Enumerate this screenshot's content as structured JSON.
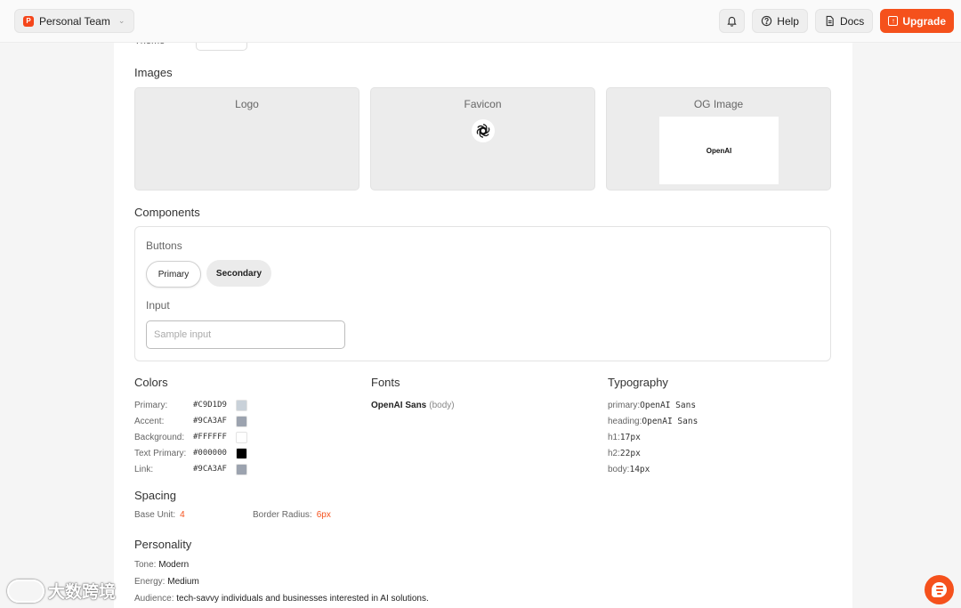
{
  "topbar": {
    "team_name": "Personal Team",
    "team_badge": "P",
    "help_label": "Help",
    "docs_label": "Docs",
    "upgrade_label": "Upgrade"
  },
  "theme": {
    "label": "Theme"
  },
  "images": {
    "title": "Images",
    "logo_label": "Logo",
    "favicon_label": "Favicon",
    "og_label": "OG Image",
    "og_text": "OpenAI"
  },
  "components": {
    "title": "Components",
    "buttons_label": "Buttons",
    "primary_label": "Primary",
    "secondary_label": "Secondary",
    "input_label": "Input",
    "input_placeholder": "Sample input"
  },
  "colors": {
    "title": "Colors",
    "items": [
      {
        "label": "Primary:",
        "value": "#C9D1D9",
        "hex": "#C9D1D9"
      },
      {
        "label": "Accent:",
        "value": "#9CA3AF",
        "hex": "#9CA3AF"
      },
      {
        "label": "Background:",
        "value": "#FFFFFF",
        "hex": "#FFFFFF"
      },
      {
        "label": "Text Primary:",
        "value": "#000000",
        "hex": "#000000"
      },
      {
        "label": "Link:",
        "value": "#9CA3AF",
        "hex": "#9CA3AF"
      }
    ]
  },
  "fonts": {
    "title": "Fonts",
    "name": "OpenAI Sans",
    "role": "(body)"
  },
  "typography": {
    "title": "Typography",
    "items": [
      {
        "label": "primary:",
        "value": "OpenAI Sans"
      },
      {
        "label": "heading:",
        "value": "OpenAI Sans"
      },
      {
        "label": "h1:",
        "value": "17px"
      },
      {
        "label": "h2:",
        "value": "22px"
      },
      {
        "label": "body:",
        "value": "14px"
      }
    ]
  },
  "spacing": {
    "title": "Spacing",
    "base_unit_label": "Base Unit:",
    "base_unit_value": "4",
    "border_radius_label": "Border Radius:",
    "border_radius_value": "6px"
  },
  "personality": {
    "title": "Personality",
    "tone_label": "Tone:",
    "tone_value": "Modern",
    "energy_label": "Energy:",
    "energy_value": "Medium",
    "audience_label": "Audience:",
    "audience_value": "tech-savvy individuals and businesses interested in AI solutions."
  },
  "watermark": {
    "text": "大数跨境"
  },
  "accent_color": "#F5511C"
}
